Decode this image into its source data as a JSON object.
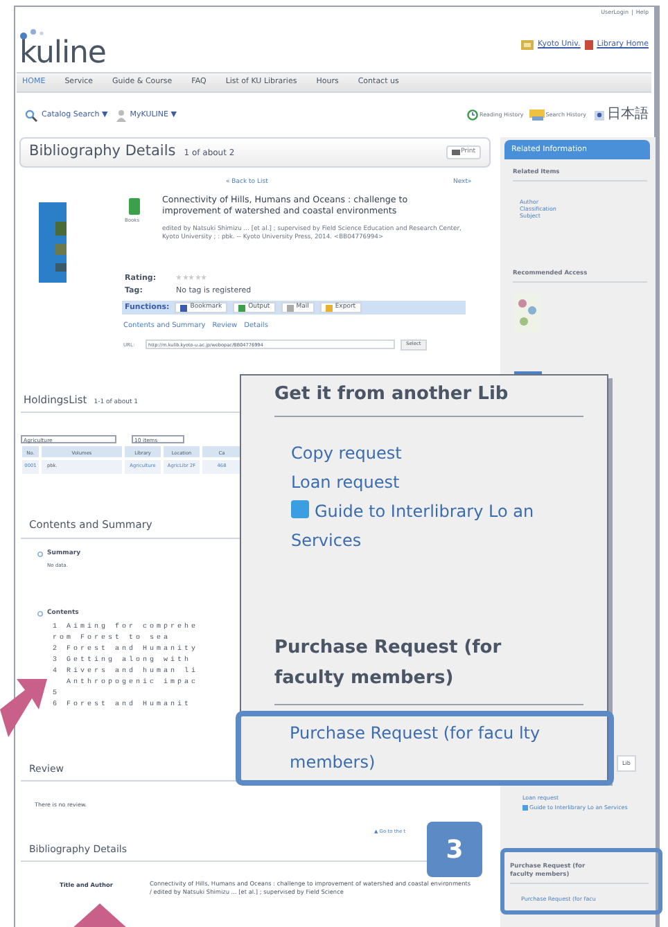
{
  "user_links": {
    "items": [
      "UserLogin",
      "Help"
    ],
    "separator": "|"
  },
  "logo": {
    "text": "kuline"
  },
  "header_links": [
    "Kyoto Univ.",
    "Library Home"
  ],
  "nav": [
    {
      "label": "HOME",
      "selected": true
    },
    {
      "label": "Service",
      "selected": false
    },
    {
      "label": "Guide & Course",
      "selected": false
    },
    {
      "label": "FAQ",
      "selected": false
    },
    {
      "label": "List of KU Libraries",
      "selected": false
    },
    {
      "label": "Hours",
      "selected": false
    },
    {
      "label": "Contact us",
      "selected": false
    }
  ],
  "toolbar": {
    "menus": [
      "Catalog Search ▼",
      "MyKULINE ▼"
    ],
    "history": [
      "Reading History",
      "Search History"
    ],
    "language": "日本語"
  },
  "details": {
    "title": "Bibliography Details",
    "count": "1 of about 2",
    "print": "Print",
    "back": "« Back to List",
    "next": "Next»",
    "format": "Books",
    "book_title": "Connectivity of Hills, Humans and Oceans : challenge to improvement of watershed and coastal environments",
    "statement": "edited by Natsuki Shimizu ... [et al.] ; supervised by Field Science Education and Research Center, Kyoto University ; : pbk. -- Kyoto University Press, 2014. <BB04776994>",
    "rating_label": "Rating:",
    "stars": 0,
    "tag_label": "Tag:",
    "tag": "No tag is registered",
    "functions_label": "Functions:",
    "functions": [
      "Bookmark",
      "Output",
      "Mail",
      "Export"
    ],
    "anchors": [
      "Contents and Summary",
      "Review",
      "Details"
    ],
    "url_label": "URL:",
    "url": "http://m.kulib.kyoto-u.ac.jp/webopac/BB04776994",
    "select": "Select"
  },
  "holdings": {
    "title": "HoldingsList",
    "count": "1-1 of about 1",
    "filter": "Agriculture",
    "per_page": "10 items",
    "columns": [
      "No.",
      "Volumes",
      "Library",
      "Location",
      "Ca"
    ],
    "rows": [
      [
        "0001",
        "pbk.",
        "Agriculture",
        "AgricLibr 2F",
        "468"
      ]
    ]
  },
  "contents": {
    "title": "Contents and Summary",
    "summary_label": "Summary",
    "summary": "No data.",
    "contents_label": "Contents",
    "lines": [
      "1 Aiming for comprehe",
      "rom Forest to sea",
      "2 Forest and Humanity",
      "3 Getting along with",
      "4 Rivers and human li",
      "  Anthropogenic impac",
      "5",
      "6 Forest and Humanit"
    ]
  },
  "review": {
    "title": "Review",
    "text": "There is no review.",
    "top_link": "▲ Go to the t"
  },
  "biblio": {
    "title": "Bibliography Details",
    "label": "Title and Author",
    "value": "Connectivity of Hills, Humans and Oceans : challenge to improvement of watershed and coastal environments / edited by Natsuki Shimizu ... [et al.] ; supervised by Field Science"
  },
  "sidebar": {
    "header": "Related Information",
    "related_title": "Related Items",
    "related": [
      "Author",
      "Classification",
      "Subject"
    ],
    "recommended_title": "Recommended Access",
    "lib_button": "Lib",
    "links": [
      "Loan request",
      "Guide to Interlibrary Lo an Services"
    ],
    "purchase_title": "Purchase Request (for faculty members)",
    "purchase_link": "Purchase Request (for facu"
  },
  "callout": {
    "title": "Get it from another Lib",
    "links": [
      {
        "label": "Copy request",
        "help": false
      },
      {
        "label": "Loan request",
        "help": false
      },
      {
        "label": "Guide to Interlibrary Lo an Services",
        "help": true
      }
    ],
    "purchase_title": "Purchase Request (for faculty members)",
    "purchase_link": "Purchase Request (for facu lty members)"
  },
  "badge": "3"
}
